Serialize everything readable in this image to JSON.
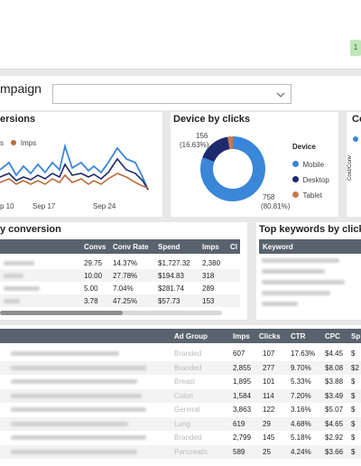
{
  "header": {
    "campaign_label": "mpaign",
    "badge_text": "1"
  },
  "conversions_card": {
    "title": "ersions",
    "legend": [
      {
        "label": "s",
        "color": "#2e82d6"
      },
      {
        "label": "Imps",
        "color": "#b96b3a"
      }
    ],
    "x_ticks": [
      "p 10",
      "Sep 17",
      "Sep 24"
    ],
    "colors": {
      "blue": "#3a86d8",
      "dark": "#1e2a6e",
      "brown": "#b96b3a"
    }
  },
  "device_card": {
    "title": "Device by clicks",
    "chart_data": {
      "type": "pie",
      "categories": [
        "Mobile",
        "Desktop",
        "Tablet"
      ],
      "values": [
        758,
        156,
        24
      ],
      "colors": [
        "#3a86d8",
        "#1e2a6e",
        "#c87a4f"
      ],
      "labels": [
        {
          "value": "758",
          "pct": "(80.81%)"
        },
        {
          "value": "156",
          "pct": "(16.63%)"
        }
      ],
      "legend_title": "Device"
    }
  },
  "cost_card": {
    "title": "Co",
    "axis_label": "Cost/Conv"
  },
  "conversion_table": {
    "title": "y conversion",
    "columns": [
      "Convs",
      "Conv Rate",
      "Spend",
      "Imps",
      "Cl"
    ],
    "rows": [
      [
        "29.75",
        "14.37%",
        "$1,727.32",
        "2,380"
      ],
      [
        "10.00",
        "27.78%",
        "$194.83",
        "318"
      ],
      [
        "5.00",
        "7.04%",
        "$281.74",
        "289"
      ],
      [
        "3.78",
        "47.25%",
        "$57.73",
        "153"
      ]
    ]
  },
  "keywords_card": {
    "title": "Top keywords by click",
    "column": "Keyword"
  },
  "adgroup_table": {
    "columns": [
      "Ad Group",
      "Imps",
      "Clicks",
      "CTR",
      "CPC",
      "Sp"
    ],
    "rows": [
      [
        "Branded",
        "607",
        "107",
        "17.63%",
        "$4.45",
        "$"
      ],
      [
        "Branded",
        "2,855",
        "277",
        "9.70%",
        "$8.08",
        "$2"
      ],
      [
        "Breast",
        "1,895",
        "101",
        "5.33%",
        "$3.88",
        "$"
      ],
      [
        "Colon",
        "1,584",
        "114",
        "7.20%",
        "$3.49",
        "$"
      ],
      [
        "General",
        "3,863",
        "122",
        "3.16%",
        "$5.07",
        "$"
      ],
      [
        "Lung",
        "619",
        "29",
        "4.68%",
        "$4.65",
        "$"
      ],
      [
        "Branded",
        "2,799",
        "145",
        "5.18%",
        "$2.92",
        "$"
      ],
      [
        "Pancreatic",
        "589",
        "25",
        "4.24%",
        "$3.66",
        "$"
      ]
    ]
  }
}
